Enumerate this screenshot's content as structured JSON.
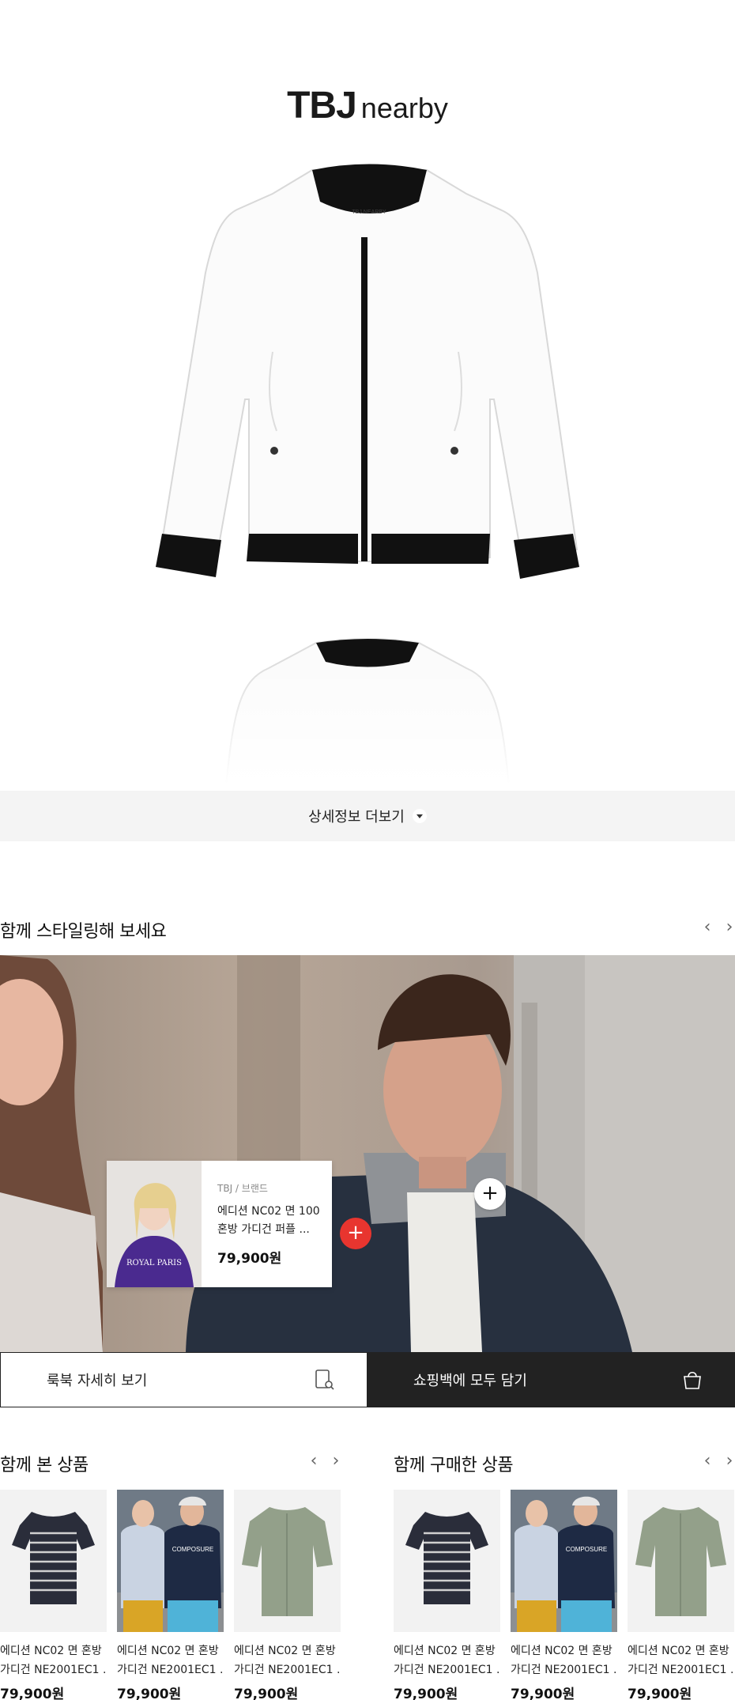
{
  "brand": {
    "logo_main": "TBJ",
    "logo_sub": "nearby",
    "neck_label": "TBJ NEARBY"
  },
  "detail": {
    "more_label": "상세정보 더보기"
  },
  "styling": {
    "title": "함께 스타일링해 보세요",
    "prev": "‹",
    "next": "›",
    "card": {
      "brand": "TBJ / 브랜드",
      "name": "에디션 NC02 면 100 혼방 가디건 퍼플 ...",
      "price": "79,900원",
      "sweatshirt_text": "ROYAL PARIS"
    },
    "plus": "+"
  },
  "actions": {
    "lookbook_label": "룩북 자세히 보기",
    "cart_label": "쇼핑백에 모두 담기"
  },
  "viewed": {
    "title": "함께 본 상품",
    "prev": "‹",
    "next": "›",
    "items": [
      {
        "name": "에디션 NC02 면 혼방",
        "name2": "가디건 NE2001EC1 ...",
        "price": "79,900원"
      },
      {
        "name": "에디션 NC02 면 혼방",
        "name2": "가디건 NE2001EC1 ...",
        "price": "79,900원"
      },
      {
        "name": "에디션 NC02 면 혼방",
        "name2": "가디건 NE2001EC1 ...",
        "price": "79,900원"
      }
    ]
  },
  "bought": {
    "title": "함께 구매한 상품",
    "prev": "‹",
    "next": "›",
    "items": [
      {
        "name": "에디션 NC02 면 혼방",
        "name2": "가디건 NE2001EC1 ...",
        "price": "79,900원"
      },
      {
        "name": "에디션 NC02 면 혼방",
        "name2": "가디건 NE2001EC1 ...",
        "price": "79,900원"
      },
      {
        "name": "에디션 NC02 면 혼방",
        "name2": "가디건 NE2001EC1 ...",
        "price": "79,900원"
      }
    ]
  },
  "tee_print": "COMPOSURE",
  "colors": {
    "accent_red": "#e8352f",
    "dark": "#222222",
    "bar_bg": "#f4f4f4"
  }
}
